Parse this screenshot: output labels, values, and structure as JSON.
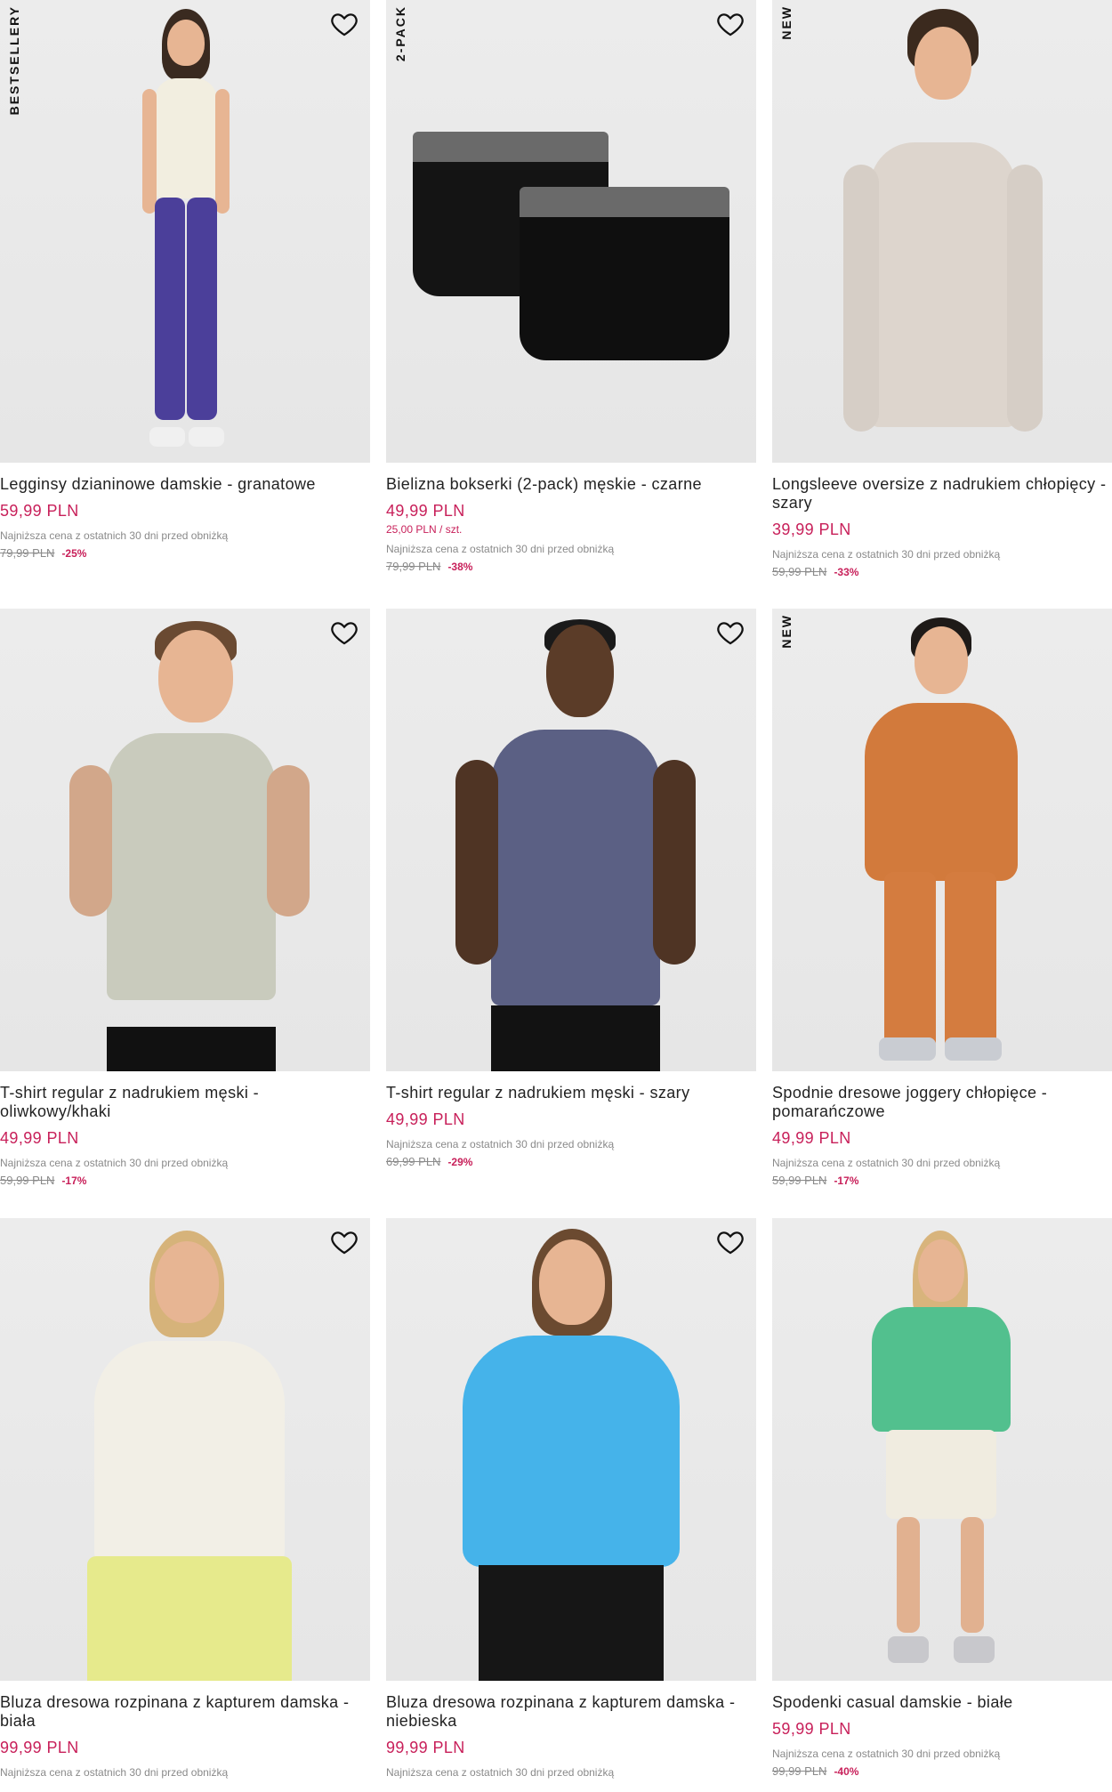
{
  "ui": {
    "wishlist_icon": "heart-outline-icon",
    "price_color": "#c8205a"
  },
  "products": [
    {
      "badge": "BESTSELLERY",
      "title": "Leggins​y dzianinowe damskie - granatowe",
      "price": "59,99 PLN",
      "unit_price": "",
      "lowest_label": "Najniższa cena z ostatnich 30 dni przed obniżką",
      "old_price": "79,99 PLN",
      "discount": "-25%"
    },
    {
      "badge": "2-PACK",
      "title": "Bielizna bokserki (2-pack) męskie - czarne",
      "price": "49,99 PLN",
      "unit_price": "25,00 PLN / szt.",
      "lowest_label": "Najniższa cena z ostatnich 30 dni przed obniżką",
      "old_price": "79,99 PLN",
      "discount": "-38%"
    },
    {
      "badge": "NEW",
      "title": "Longsleeve oversize z nadrukiem chłopięcy - szary",
      "price": "39,99 PLN",
      "unit_price": "",
      "lowest_label": "Najniższa cena z ostatnich 30 dni przed obniżką",
      "old_price": "59,99 PLN",
      "discount": "-33%"
    },
    {
      "badge": "",
      "title": "T-shirt regular z nadrukiem męski - oliwkowy/khaki",
      "price": "49,99 PLN",
      "unit_price": "",
      "lowest_label": "Najniższa cena z ostatnich 30 dni przed obniżką",
      "old_price": "59,99 PLN",
      "discount": "-17%"
    },
    {
      "badge": "",
      "title": "T-shirt regular z nadrukiem męski - szary",
      "price": "49,99 PLN",
      "unit_price": "",
      "lowest_label": "Najniższa cena z ostatnich 30 dni przed obniżką",
      "old_price": "69,99 PLN",
      "discount": "-29%"
    },
    {
      "badge": "NEW",
      "title": "Spodnie dresowe joggery chłopięce - pomarańczowe",
      "price": "49,99 PLN",
      "unit_price": "",
      "lowest_label": "Najniższa cena z ostatnich 30 dni przed obniżką",
      "old_price": "59,99 PLN",
      "discount": "-17%"
    },
    {
      "badge": "",
      "title": "Bluza dresowa rozpinana z kapturem damska - biała",
      "price": "99,99 PLN",
      "unit_price": "",
      "lowest_label": "Najniższa cena z ostatnich 30 dni przed obniżką",
      "old_price": "",
      "discount": ""
    },
    {
      "badge": "",
      "title": "Bluza dresowa rozpinana z kapturem damska - niebieska",
      "price": "99,99 PLN",
      "unit_price": "",
      "lowest_label": "Najniższa cena z ostatnich 30 dni przed obniżką",
      "old_price": "",
      "discount": ""
    },
    {
      "badge": "",
      "title": "Spodenki casual damskie - białe",
      "price": "59,99 PLN",
      "unit_price": "",
      "lowest_label": "Najniższa cena z ostatnich 30 dni przed obniżką",
      "old_price": "99,99 PLN",
      "discount": "-40%"
    }
  ]
}
